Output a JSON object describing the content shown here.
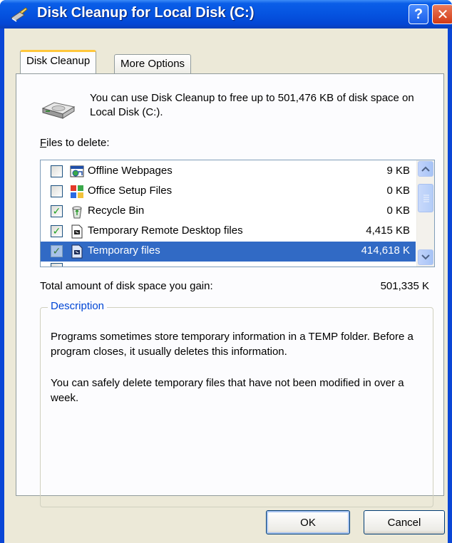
{
  "window": {
    "title": "Disk Cleanup for Local Disk (C:)",
    "help_glyph": "?",
    "close_glyph": "✕"
  },
  "tabs": [
    {
      "label": "Disk Cleanup",
      "selected": true
    },
    {
      "label": "More Options",
      "selected": false
    }
  ],
  "info": {
    "text": "You can use Disk Cleanup to free up to 501,476 KB of disk space on Local Disk (C:)."
  },
  "files": {
    "label": "Files to delete:",
    "items": [
      {
        "name": "Offline Webpages",
        "size": "9 KB",
        "checked": false,
        "selected": false,
        "icon": "offline-webpages-icon"
      },
      {
        "name": "Office Setup Files",
        "size": "0 KB",
        "checked": false,
        "selected": false,
        "icon": "office-setup-icon"
      },
      {
        "name": "Recycle Bin",
        "size": "0 KB",
        "checked": true,
        "selected": false,
        "icon": "recycle-bin-icon"
      },
      {
        "name": "Temporary Remote Desktop files",
        "size": "4,415 KB",
        "checked": true,
        "selected": false,
        "icon": "remote-desktop-icon"
      },
      {
        "name": "Temporary files",
        "size": "414,618 K",
        "checked": true,
        "selected": true,
        "icon": "temporary-files-icon"
      }
    ],
    "check_glyph": "✓"
  },
  "total": {
    "label": "Total amount of disk space you gain:",
    "value": "501,335 K"
  },
  "description": {
    "legend": "Description",
    "paragraph1": "Programs sometimes store temporary information in a TEMP folder. Before a program closes, it usually deletes this information.",
    "paragraph2": "You can safely delete temporary files that have not been modified in over a week."
  },
  "buttons": {
    "ok": "OK",
    "cancel": "Cancel"
  },
  "colors": {
    "title_bar": "#0553e0",
    "selection": "#316ac5",
    "dialog_face": "#ece9d8",
    "legend_text": "#0046d5"
  }
}
